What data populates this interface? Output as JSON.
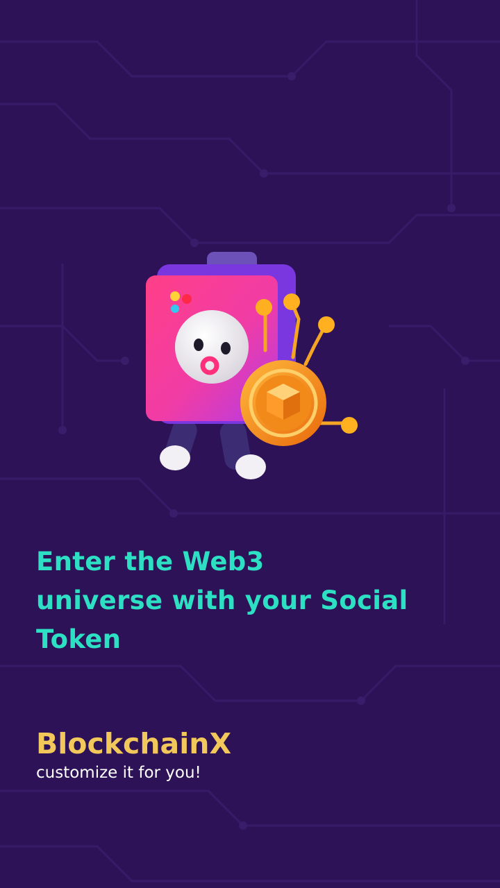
{
  "hero": {
    "illustration_icon": "robot-with-coin-icon"
  },
  "headline": {
    "line1": "Enter the Web3",
    "line2": "universe with your Social",
    "line3": "Token"
  },
  "brand": {
    "name": "BlockchainX",
    "tagline": "customize it for you!"
  },
  "colors": {
    "background": "#2d1257",
    "headline": "#2ee0c3",
    "brand": "#f2c85b",
    "tagline": "#ffffff"
  }
}
